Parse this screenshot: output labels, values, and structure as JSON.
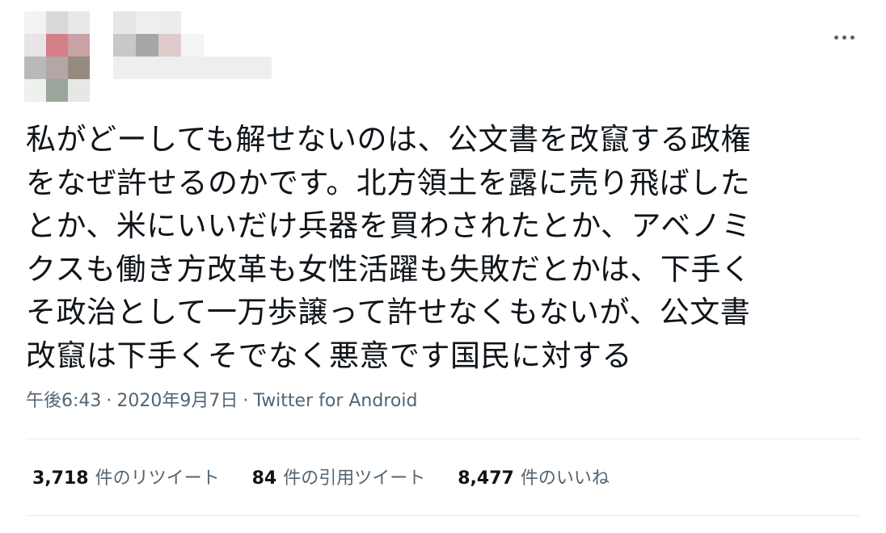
{
  "tweet": {
    "text_lines": [
      "私がどーしても解せないのは、公文書を改竄する政権",
      "をなぜ許せるのかです。北方領土を露に売り飛ばした",
      "とか、米にいいだけ兵器を買わされたとか、アベノミ",
      "クスも働き方改革も女性活躍も失敗だとかは、下手く",
      "そ政治として一万歩譲って許せなくもないが、公文書",
      "改竄は下手くそでなく悪意です国民に対する"
    ],
    "time": "午後6:43",
    "date": "2020年9月7日",
    "source": "Twitter for Android",
    "separator": "·"
  },
  "stats": [
    {
      "count": "3,718",
      "label": "件のリツイート"
    },
    {
      "count": "84",
      "label": "件の引用ツイート"
    },
    {
      "count": "8,477",
      "label": "件のいいね"
    }
  ],
  "icons": {
    "more": "more-horizontal-icon"
  },
  "colors": {
    "text": "#0f1419",
    "secondary": "#536471",
    "divider": "#e6ecf0"
  }
}
